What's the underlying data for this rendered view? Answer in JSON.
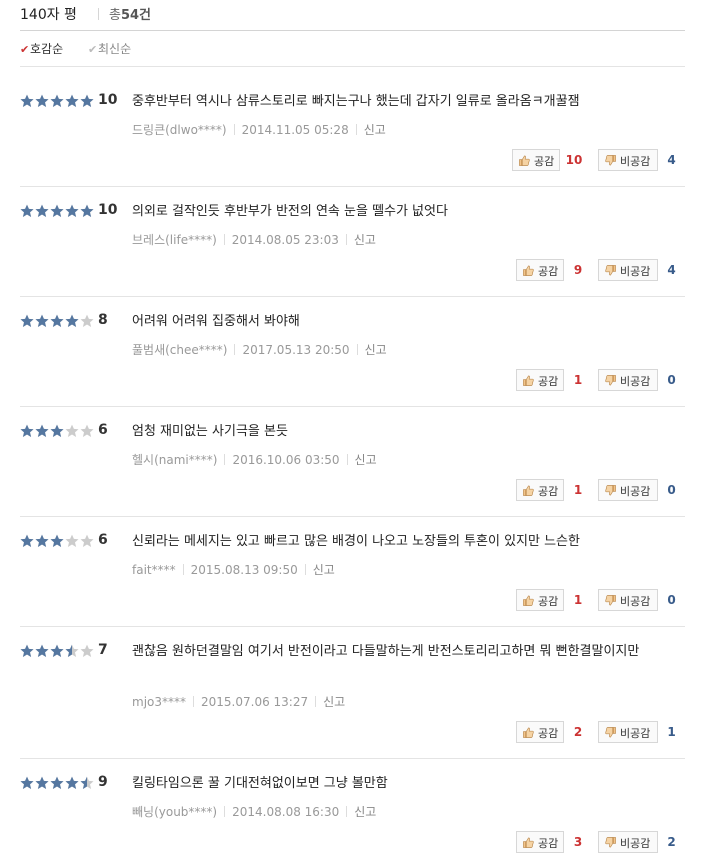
{
  "header": {
    "title": "140자 평",
    "count_prefix": "총",
    "count": "54건"
  },
  "sort": {
    "items": [
      {
        "label": "호감순",
        "active": true
      },
      {
        "label": "최신순",
        "active": false
      }
    ]
  },
  "labels": {
    "agree": "공감",
    "disagree": "비공감",
    "report": "신고"
  },
  "colors": {
    "star_on": "#5577a0",
    "star_off": "#cccccc",
    "agree_count": "#cc3333",
    "disagree_count": "#385b8a"
  },
  "reviews": [
    {
      "stars": 5,
      "score": "10",
      "text": "중후반부터 역시나 삼류스토리로 빠지는구나 했는데 갑자기 일류로 올라옴ㅋ개꿀잼",
      "user": "드링큰(dlwo****)",
      "date": "2014.11.05 05:28",
      "agree": "10",
      "disagree": "4"
    },
    {
      "stars": 5,
      "score": "10",
      "text": "의외로 걸작인듯 후반부가 반전의 연속 눈을 뗄수가 넚엇다",
      "user": "브레스(life****)",
      "date": "2014.08.05 23:03",
      "agree": "9",
      "disagree": "4"
    },
    {
      "stars": 4,
      "score": "8",
      "text": "어려워 어려워 집중해서 봐야해",
      "user": "풀범새(chee****)",
      "date": "2017.05.13 20:50",
      "agree": "1",
      "disagree": "0"
    },
    {
      "stars": 3,
      "score": "6",
      "text": "엄청 재미없는 사기극을 본듯",
      "user": "헬시(nami****)",
      "date": "2016.10.06 03:50",
      "agree": "1",
      "disagree": "0"
    },
    {
      "stars": 3,
      "score": "6",
      "text": "신뢰라는 메세지는 있고 빠르고 많은 배경이 나오고 노장들의 투혼이 있지만 느슨한",
      "user": "fait****",
      "date": "2015.08.13 09:50",
      "agree": "1",
      "disagree": "0"
    },
    {
      "stars": 3.5,
      "score": "7",
      "text": "괜찮음 원하던결말임 여기서 반전이라고 다들말하는게 반전스토리리고하면 뭐 뻔한결말이지만",
      "user": "mjo3****",
      "date": "2015.07.06 13:27",
      "agree": "2",
      "disagree": "1"
    },
    {
      "stars": 4.5,
      "score": "9",
      "text": "킬링타임으론 꿀 기대전혀없이보면 그냥 볼만함",
      "user": "빼닝(youb****)",
      "date": "2014.08.08 16:30",
      "agree": "3",
      "disagree": "2"
    }
  ]
}
